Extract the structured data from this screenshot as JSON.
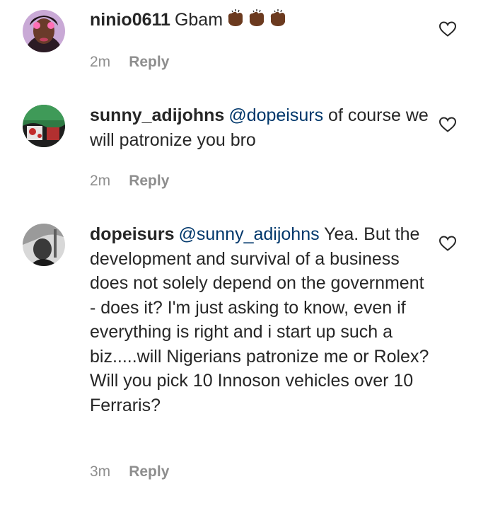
{
  "comments": [
    {
      "username": "ninio0611",
      "text": "Gbam",
      "emoji": "👏🏾👏🏾👏🏾",
      "time": "2m",
      "reply_label": "Reply"
    },
    {
      "username": "sunny_adijohns",
      "mention": "@dopeisurs",
      "text": " of course we will patronize you bro",
      "time": "2m",
      "reply_label": "Reply"
    },
    {
      "username": "dopeisurs",
      "mention": "@sunny_adijohns",
      "text": " Yea. But the development and survival of a business does not solely depend on the government - does it? I'm just asking to know, even if everything is right and i start up such a biz.....will Nigerians patronize me or Rolex? Will you pick 10 Innoson vehicles over 10 Ferraris?",
      "time": "3m",
      "reply_label": "Reply"
    }
  ],
  "icons": {
    "like": "heart-outline-icon",
    "emoji_color": "#6b3a1f"
  }
}
